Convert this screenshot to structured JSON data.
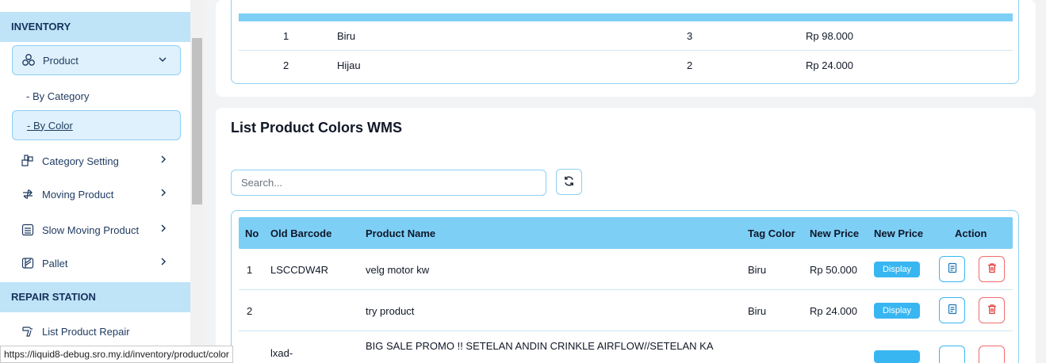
{
  "sidebar": {
    "inventory_heading": "INVENTORY",
    "product": {
      "label": "Product",
      "icon": "boxes-icon"
    },
    "sub_items": [
      "- By Category",
      "- By Color"
    ],
    "items": [
      {
        "label": "Category Setting",
        "icon": "category-icon"
      },
      {
        "label": "Moving Product",
        "icon": "moving-arrows-icon"
      },
      {
        "label": "Slow Moving Product",
        "icon": "box-list-icon"
      },
      {
        "label": "Pallet",
        "icon": "pallet-icon"
      }
    ],
    "repair_heading": "REPAIR STATION",
    "repair_items": [
      {
        "label": "List Product Repair",
        "icon": "repair-icon"
      }
    ]
  },
  "status_url": "https://liquid8-debug.sro.my.id/inventory/product/color",
  "top_table": {
    "rows": [
      {
        "no": "1",
        "color": "Biru",
        "qty": "3",
        "price": "Rp 98.000"
      },
      {
        "no": "2",
        "color": "Hijau",
        "qty": "2",
        "price": "Rp 24.000"
      }
    ]
  },
  "main": {
    "title": "List Product Colors WMS",
    "search_placeholder": "Search...",
    "columns": [
      "No",
      "Old Barcode",
      "Product Name",
      "Tag Color",
      "New Price",
      "New Price",
      "Action"
    ],
    "rows": [
      {
        "no": "1",
        "barcode": "LSCCDW4R",
        "name": "velg motor kw",
        "tag": "Biru",
        "price": "Rp 50.000",
        "display": "Display"
      },
      {
        "no": "2",
        "barcode": "",
        "name": "try product",
        "tag": "Biru",
        "price": "Rp 24.000",
        "display": "Display"
      },
      {
        "no": "",
        "barcode": "lxad-",
        "name": "BIG SALE PROMO !! SETELAN ANDIN CRINKLE AIRFLOW//SETELAN KA",
        "tag": "",
        "price": "",
        "display": ""
      }
    ]
  },
  "colors": {
    "accent": "#7dcff5",
    "badge": "#38b6f1",
    "danger": "#f26b6b",
    "section": "#bfe3f7"
  }
}
